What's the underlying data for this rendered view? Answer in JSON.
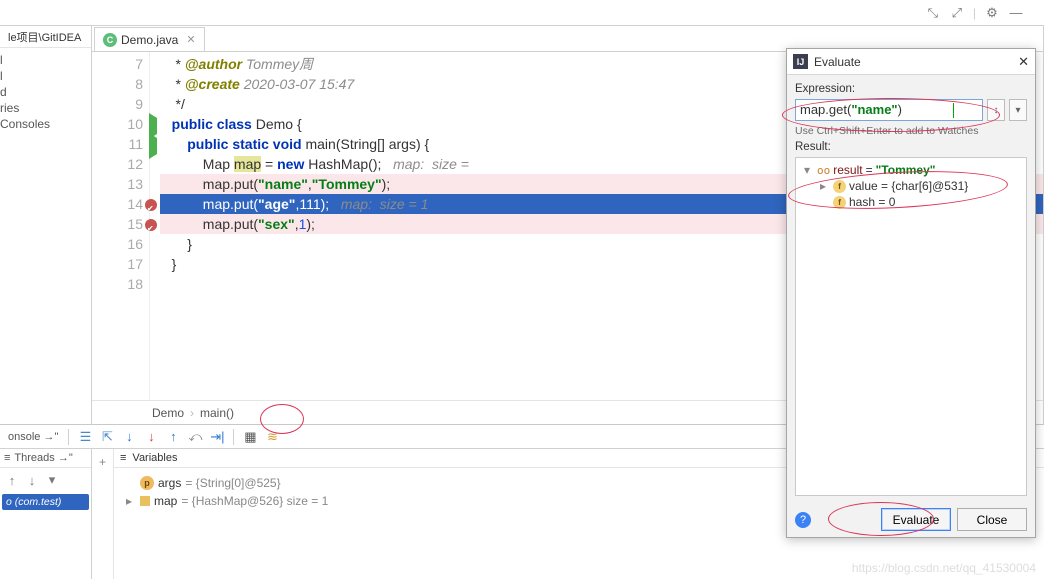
{
  "top_toolbar": {
    "icons": [
      "collapse",
      "expand",
      "divider",
      "gear",
      "hide"
    ]
  },
  "path_bar": "le项目\\GitIDEA",
  "side_tree": [
    "l",
    "l",
    "d",
    "ries",
    "Consoles"
  ],
  "tab": {
    "name": "Demo.java"
  },
  "code": {
    "lines": [
      {
        "n": 7,
        "html": "    * <span class='ann'>@author</span> <span class='cmt'>Tommey周</span>"
      },
      {
        "n": 8,
        "html": "    * <span class='ann'>@create</span> <span class='cmt'>2020-03-07 15:47</span>"
      },
      {
        "n": 9,
        "html": "    */"
      },
      {
        "n": 10,
        "mark": "run",
        "html": "   <span class='kw'>public class</span> Demo {"
      },
      {
        "n": 11,
        "mark": "run",
        "html": "       <span class='kw'>public static void</span> main(String[] args) {"
      },
      {
        "n": 12,
        "html": "           Map <span class='hl'>map</span> = <span class='kw'>new</span> HashMap();   <span class='ghost'>map:  size =</span>"
      },
      {
        "n": 13,
        "cls": "near-bp",
        "html": "           map.put(<span class='str'>\"name\"</span>,<span class='str'>\"Tommey\"</span>);"
      },
      {
        "n": 14,
        "mark": "bp",
        "cls": "exec-line",
        "html": "           map.put(<span class='str'>\"age\"</span>,<span class='num'>111</span>);   <span class='ghost'>map:  size = 1</span>"
      },
      {
        "n": 15,
        "mark": "bp",
        "cls": "near-bp",
        "html": "           map.put(<span class='str'>\"sex\"</span>,<span class='num'>1</span>);"
      },
      {
        "n": 16,
        "html": "       }"
      },
      {
        "n": 17,
        "html": "   }"
      },
      {
        "n": 18,
        "html": ""
      }
    ]
  },
  "breadcrumb": {
    "a": "Demo",
    "b": "main()"
  },
  "debug": {
    "console_label": "onsole →\"",
    "threads_label": "Threads →\"",
    "vars_label": "Variables",
    "frame_item": "o (com.test)",
    "vars": [
      {
        "icon": "p",
        "name": "args",
        "val": "= {String[0]@525}"
      },
      {
        "icon": "y",
        "name": "map",
        "val": "= {HashMap@526}  size = 1",
        "expand": true
      }
    ]
  },
  "evaluate": {
    "title": "Evaluate",
    "expr_label": "Expression:",
    "expr_html": "map.get(<span class='str'>\"name\"</span>)",
    "hint": "Use Ctrl+Shift+Enter to add to Watches",
    "result_label": "Result:",
    "result_root": {
      "name": "result",
      "eq": "=",
      "val": "\"Tommey\""
    },
    "result_children": [
      {
        "icon": "f",
        "name": "value",
        "tail": "= {char[6]@531}",
        "expand": true
      },
      {
        "icon": "f",
        "name": "hash",
        "tail": "= 0"
      }
    ],
    "btn_eval": "Evaluate",
    "btn_close": "Close"
  },
  "watermark": "https://blog.csdn.net/qq_41530004"
}
